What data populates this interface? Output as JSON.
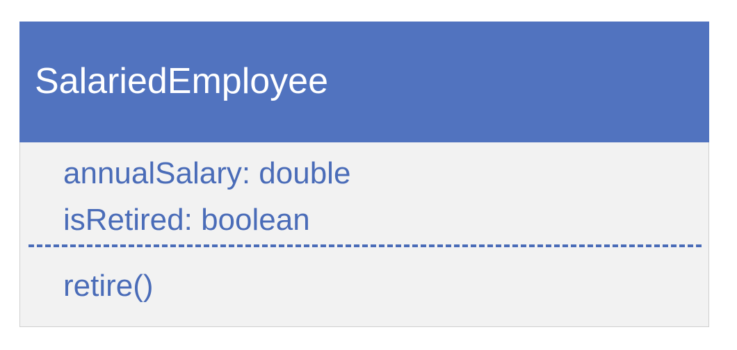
{
  "class_box": {
    "name": "SalariedEmployee",
    "attributes": [
      "annualSalary: double",
      "isRetired: boolean"
    ],
    "methods": [
      "retire()"
    ]
  },
  "colors": {
    "header": "#5173bf",
    "body": "#f2f2f2",
    "text_accent": "#4a6cb8",
    "header_text": "#ffffff"
  }
}
